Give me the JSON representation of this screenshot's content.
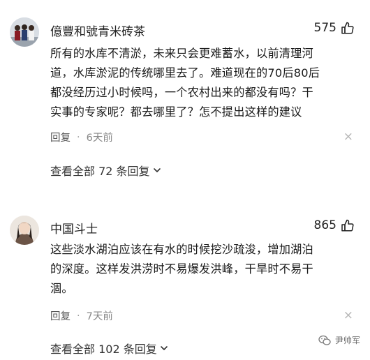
{
  "comments": [
    {
      "username": "億豐和號青米砖茶",
      "likes": "575",
      "lines": [
        "所有的水库不清淤，未来只会更难蓄水，以前清理河",
        "道，水库淤泥的传统哪里去了。难道现在的70后80后",
        "都没经历过小时候吗，一个农村出来的都没有吗？干",
        "实事的专家呢？都去哪里了？怎不提出这样的建议"
      ],
      "reply_label": "回复",
      "separator": "·",
      "time": "6天前",
      "close_glyph": "×",
      "view_all": "查看全部 72 条回复"
    },
    {
      "username": "中国斗士",
      "likes": "865",
      "lines": [
        "这些淡水湖泊应该在有水的时候挖沙疏浚，增加湖泊",
        "的深度。这样发洪涝时不易爆发洪峰，干旱时不易干",
        "涸。"
      ],
      "reply_label": "回复",
      "separator": "·",
      "time": "7天前",
      "close_glyph": "×",
      "view_all": "查看全部 102 条回复"
    }
  ],
  "watermark": {
    "text": "尹帅军"
  }
}
